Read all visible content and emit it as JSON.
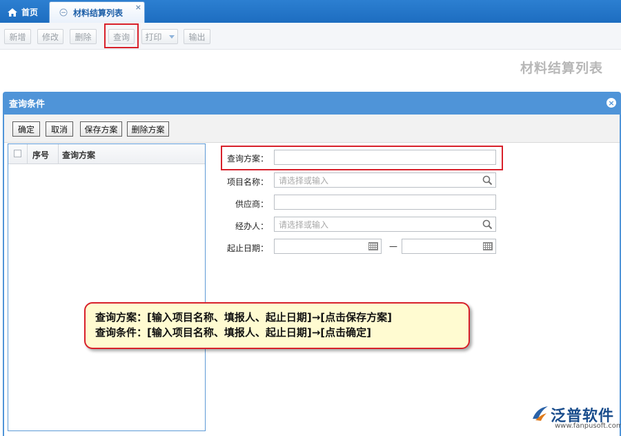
{
  "tabs": {
    "home": "首页",
    "active": "材料结算列表",
    "close": "×"
  },
  "toolbar": {
    "add": "新增",
    "edit": "修改",
    "delete": "删除",
    "query": "查询",
    "print": "打印",
    "export": "输出"
  },
  "page_title": "材料结算列表",
  "dialog": {
    "title": "查询条件",
    "close": "×",
    "buttons": {
      "confirm": "确定",
      "cancel": "取消",
      "save_scheme": "保存方案",
      "delete_scheme": "删除方案"
    },
    "list": {
      "col_no": "序号",
      "col_scheme": "查询方案"
    },
    "form": {
      "scheme_label": "查询方案：",
      "scheme_value": "",
      "project_label": "项目名称：",
      "project_placeholder": "请选择或输入",
      "supplier_label": "供应商：",
      "supplier_value": "",
      "handler_label": "经办人：",
      "handler_placeholder": "请选择或输入",
      "date_label": "起止日期：",
      "date_sep": "—",
      "date_from": "",
      "date_to": ""
    }
  },
  "note": {
    "line1": "查询方案：[输入项目名称、填报人、起止日期]→[点击保存方案]",
    "line2": "查询条件：[输入项目名称、填报人、起止日期]→[点击确定]"
  },
  "logo": {
    "name": "泛普软件",
    "url": "www.fanpusoft.com"
  },
  "colors": {
    "accent": "#4f94d8",
    "highlight": "#d8202a",
    "note_bg": "#fffbd1"
  }
}
